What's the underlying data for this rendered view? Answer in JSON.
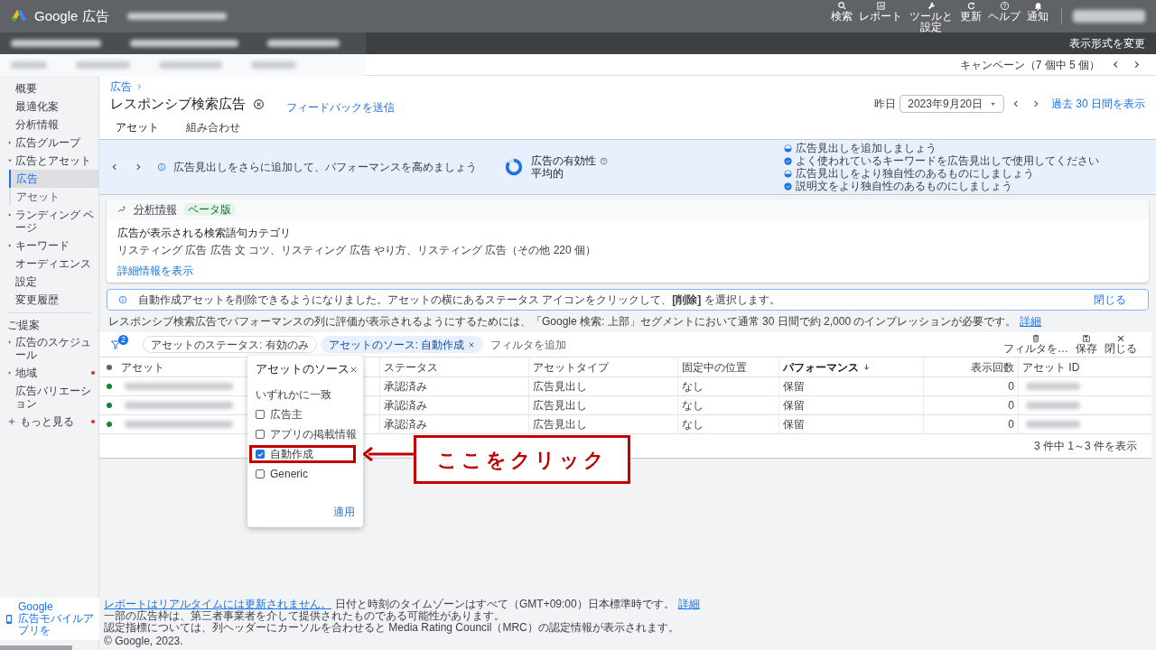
{
  "header": {
    "product": "Google 広告",
    "tools": [
      {
        "kind": "search",
        "label": "検索"
      },
      {
        "kind": "reports",
        "label": "レポート"
      },
      {
        "kind": "tools",
        "label": "ツールと設定"
      },
      {
        "kind": "refresh",
        "label": "更新"
      },
      {
        "kind": "help",
        "label": "ヘルプ"
      },
      {
        "kind": "bell",
        "label": "通知"
      }
    ],
    "view_toggle": "表示形式を変更",
    "campaign_nav": "キャンペーン（7 個中 5 個）"
  },
  "sidebar": {
    "items": [
      {
        "label": "概要",
        "expandable": false,
        "selected": false
      },
      {
        "label": "最適化案",
        "expandable": false,
        "selected": false
      },
      {
        "label": "分析情報",
        "expandable": false,
        "selected": false
      },
      {
        "label": "広告グループ",
        "expandable": true,
        "expanded": false,
        "selected": false
      },
      {
        "label": "広告とアセット",
        "expandable": true,
        "expanded": true,
        "selected": false,
        "children": [
          {
            "label": "広告",
            "selected": true
          },
          {
            "label": "アセット",
            "selected": false
          }
        ]
      },
      {
        "label": "ランディング ページ",
        "expandable": true,
        "expanded": false,
        "selected": false
      },
      {
        "label": "キーワード",
        "expandable": true,
        "expanded": false,
        "selected": false
      },
      {
        "label": "オーディエンス",
        "expandable": false,
        "selected": false
      },
      {
        "label": "設定",
        "expandable": false,
        "selected": false
      },
      {
        "label": "変更履歴",
        "expandable": false,
        "selected": false
      }
    ],
    "section_title": "ご提案",
    "suggestions": [
      {
        "label": "広告のスケジュール",
        "expandable": true,
        "alert": false
      },
      {
        "label": "地域",
        "expandable": true,
        "alert": true
      },
      {
        "label": "広告バリエーション",
        "expandable": false,
        "alert": false
      }
    ],
    "more": {
      "label": "もっと見る",
      "alert": true
    },
    "app_promo": {
      "title": "Google",
      "text": "広告モバイルアプリを"
    }
  },
  "page": {
    "breadcrumb": "広告",
    "title": "レスポンシブ検索広告",
    "feedback": "フィードバックを送信",
    "tabs": [
      {
        "label": "アセット",
        "selected": true
      },
      {
        "label": "組み合わせ",
        "selected": false
      }
    ],
    "date_label": "昨日",
    "date": "2023年9月20日",
    "range_link": "過去 30 日間を表示"
  },
  "strength": {
    "message": "広告見出しをさらに追加して、パフォーマンスを高めましょう",
    "title": "広告の有効性",
    "rating": "平均的",
    "level": 0.85,
    "checklist": [
      {
        "kind": "partial",
        "text": "広告見出しを追加しましょう"
      },
      {
        "kind": "done",
        "text": "よく使われているキーワードを広告見出しで使用してください"
      },
      {
        "kind": "partial",
        "text": "広告見出しをより独自性のあるものにしましょう"
      },
      {
        "kind": "done",
        "text": "説明文をより独自性のあるものにしましょう"
      }
    ]
  },
  "insights": {
    "title": "分析情報",
    "badge": "ベータ版",
    "heading": "広告が表示される検索語句カテゴリ",
    "body": "リスティング 広告 広告 文 コツ、リスティング 広告 やり方、リスティング 広告（その他 220 個）",
    "link": "詳細情報を表示"
  },
  "notice": {
    "text": "自動作成アセットを削除できるようになりました。アセットの横にあるステータス アイコンをクリックして、**[削除]** を選択します。",
    "close": "閉じる"
  },
  "requirement": {
    "text": "レスポンシブ検索広告でパフォーマンスの列に評価が表示されるようにするためには、「Google 検索: 上部」セグメントにおいて通常 30 日間で約 2,000 のインプレッションが必要です。",
    "link": "詳細"
  },
  "filters": {
    "count": "2",
    "chips": [
      {
        "label": "アセットのステータス: 有効のみ",
        "selected": false
      },
      {
        "label": "アセットのソース: 自動作成",
        "selected": true
      }
    ],
    "add": "フィルタを追加",
    "actions": [
      {
        "kind": "delete",
        "label": "フィルタを…"
      },
      {
        "kind": "save",
        "label": "保存"
      },
      {
        "kind": "close",
        "label": "閉じる"
      }
    ]
  },
  "table": {
    "columns": [
      {
        "label": "アセット",
        "sorted": false
      },
      {
        "label": "ステータス",
        "sorted": false
      },
      {
        "label": "アセットタイプ",
        "sorted": false
      },
      {
        "label": "固定中の位置",
        "sorted": false
      },
      {
        "label": "パフォーマンス",
        "sorted": true
      },
      {
        "label": "表示回数",
        "sorted": false
      },
      {
        "label": "アセット ID",
        "sorted": false
      }
    ],
    "rows": [
      {
        "status": "承認済み",
        "type": "広告見出し",
        "pinned": "なし",
        "performance": "保留",
        "impressions": "0"
      },
      {
        "status": "承認済み",
        "type": "広告見出し",
        "pinned": "なし",
        "performance": "保留",
        "impressions": "0"
      },
      {
        "status": "承認済み",
        "type": "広告見出し",
        "pinned": "なし",
        "performance": "保留",
        "impressions": "0"
      }
    ],
    "pagination": "3 件中 1～3 件を表示"
  },
  "popup": {
    "title": "アセットのソース",
    "subtitle": "いずれかに一致",
    "options": [
      {
        "label": "広告主",
        "checked": false
      },
      {
        "label": "アプリの掲載情報",
        "checked": false
      },
      {
        "label": "自動作成",
        "checked": true
      },
      {
        "label": "Generic",
        "checked": false
      }
    ],
    "apply": "適用"
  },
  "annotation": {
    "label": "ここをクリック"
  },
  "footer": {
    "realtime_link": "レポートはリアルタイムには更新されません。",
    "timezone": "日付と時刻のタイムゾーンはすべて（GMT+09:00）日本標準時です。",
    "details_link": "詳細",
    "lines": [
      "一部の広告枠は、第三者事業者を介して提供されたものである可能性があります。",
      "認定指標については、列ヘッダーにカーソルを合わせると Media Rating Council（MRC）の認定情報が表示されます。"
    ],
    "copyright": "© Google, 2023."
  }
}
